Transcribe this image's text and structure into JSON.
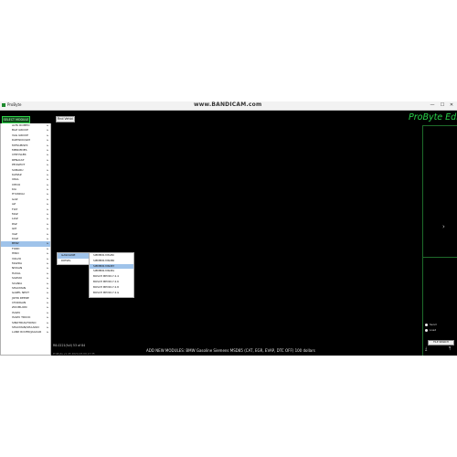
{
  "titlebar": {
    "app_title": "ProByte",
    "watermark": "www.BANDICAM.com",
    "min": "—",
    "max": "☐",
    "close": "✕"
  },
  "toolbar": {
    "menu_button": "SELECT MODULE",
    "find_button": "Find Vehicl"
  },
  "logo": "ProByte Edit",
  "menu": {
    "items": [
      {
        "label": "ALFA ROMEO"
      },
      {
        "label": "BAZ GROUP"
      },
      {
        "label": "VAG GROUP"
      },
      {
        "label": "DAEWOO/GM"
      },
      {
        "label": "MITSUBISHI"
      },
      {
        "label": "MERCEDES"
      },
      {
        "label": "CHRYSLER"
      },
      {
        "label": "RENAULT"
      },
      {
        "label": "PEUGEOT"
      },
      {
        "label": "SUBARU"
      },
      {
        "label": "KAMAZ"
      },
      {
        "label": "URAL"
      },
      {
        "label": "IVECO"
      },
      {
        "label": "KIA"
      },
      {
        "label": "HYUNDAI"
      },
      {
        "label": "GAZ"
      },
      {
        "label": "AZ"
      },
      {
        "label": "FIAT"
      },
      {
        "label": "MAZ"
      },
      {
        "label": "LIAZ"
      },
      {
        "label": "PAZ"
      },
      {
        "label": "GM"
      },
      {
        "label": "VAZ"
      },
      {
        "label": "KIAZ"
      },
      {
        "label": "BMW"
      },
      {
        "label": "FORD"
      },
      {
        "label": "HINO"
      },
      {
        "label": "VOLVO"
      },
      {
        "label": "MAZDA"
      },
      {
        "label": "NISSAN"
      },
      {
        "label": "HAVAL"
      },
      {
        "label": "SUZUKI"
      },
      {
        "label": "SCANIA"
      },
      {
        "label": "SHACMAN"
      },
      {
        "label": "GAZEL NEXT"
      },
      {
        "label": "JOHN DEERE"
      },
      {
        "label": "CHANGAN"
      },
      {
        "label": "ZOOMLION"
      },
      {
        "label": "ISUZU"
      },
      {
        "label": "ISUZU TRUCK"
      },
      {
        "label": "SINOTRUK/HOWO"
      },
      {
        "label": "SHACMAN/SHAANXI"
      },
      {
        "label": "LAND ROVER/JAGUAR"
      }
    ],
    "selected_index": 24
  },
  "submenu1": {
    "items": [
      {
        "label": "GASOLINE"
      },
      {
        "label": "DIESEL"
      }
    ],
    "selected_index": 0
  },
  "submenu2": {
    "items": [
      {
        "label": "SIEMENS MSV80"
      },
      {
        "label": "SIEMENS MSD80"
      },
      {
        "label": "SIEMENS MSD87"
      },
      {
        "label": "SIEMENS MSD81"
      },
      {
        "label": "BOSCH MEVD17.2.4"
      },
      {
        "label": "BOSCH MEVD17.2.6"
      },
      {
        "label": "BOSCH MEVD17.2.8"
      },
      {
        "label": "BOSCH MEVD17.2.G"
      }
    ],
    "selected_index": 2
  },
  "right_panel": {
    "radio1": "Send",
    "radio2": "Load",
    "button": "FILE SEARCH"
  },
  "status": {
    "left": "R8-0221(full) 53 of 84",
    "left2": "ProByte v1.45 2024-03-09 17:35",
    "ticker": "ADD NEW MODULES: BMW Gasoline Siemens MSD85 (CAT, EGR, EVAP, DTC OFF) 100 dollars"
  }
}
